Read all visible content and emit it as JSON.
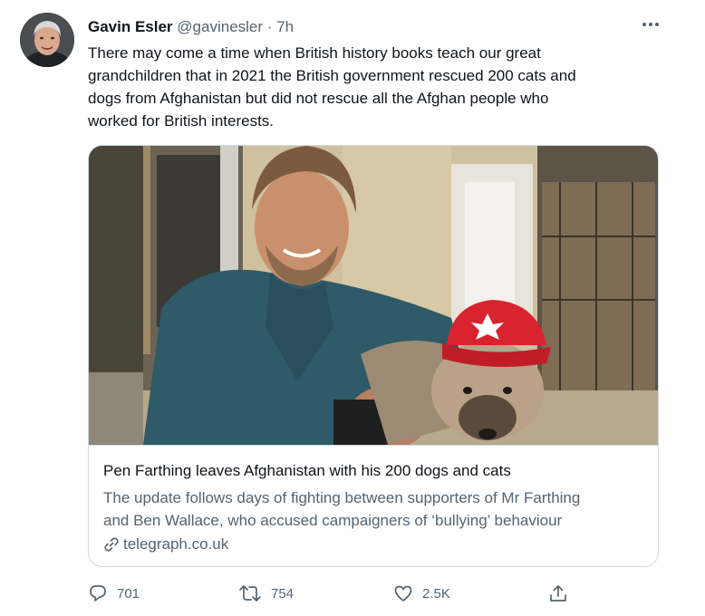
{
  "author": {
    "name": "Gavin Esler",
    "handle": "@gavinesler",
    "separator": "·",
    "time": "7h"
  },
  "tweet": {
    "lines": [
      "There may come a time when British history books teach our great",
      "grandchildren that in 2021 the British government rescued 200 cats and",
      "dogs from Afghanistan but did not rescue all the Afghan people who",
      "worked for British interests."
    ]
  },
  "card": {
    "title": "Pen Farthing leaves Afghanistan with his 200 dogs and cats",
    "description_lines": [
      "The update follows days of fighting between supporters of Mr Farthing",
      "and Ben Wallace, who accused campaigners of ‘bullying’ behaviour"
    ],
    "domain": "telegraph.co.uk"
  },
  "actions": {
    "replies": "701",
    "retweets": "754",
    "likes": "2.5K"
  },
  "icons": [
    "more-icon",
    "reply-icon",
    "retweet-icon",
    "like-icon",
    "share-icon",
    "link-icon"
  ],
  "colors": {
    "text": "#0f1419",
    "secondary": "#536471",
    "border": "#cfd9de"
  }
}
